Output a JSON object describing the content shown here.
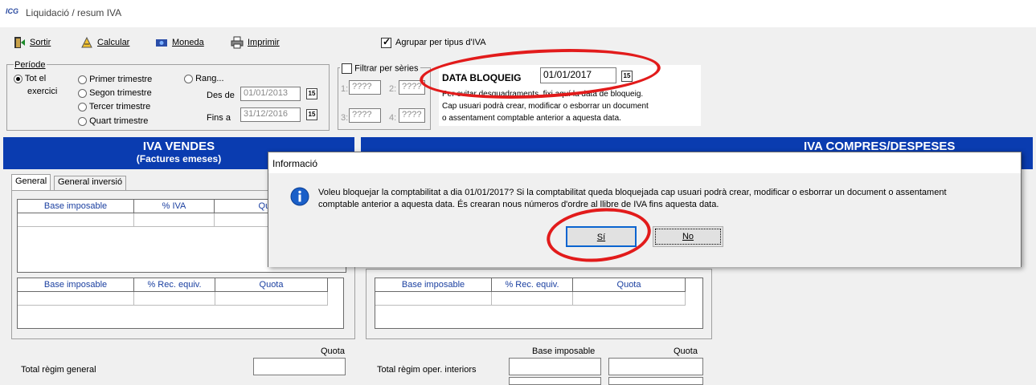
{
  "window": {
    "logo": "ICG",
    "title": "Liquidació / resum IVA"
  },
  "toolbar": {
    "sortir": "Sortir",
    "calcular": "Calcular",
    "moneda": "Moneda",
    "imprimir": "Imprimir",
    "agrupar": "Agrupar per tipus d'IVA",
    "agrupar_checked": true
  },
  "periode": {
    "label": "Període",
    "tot_el": "Tot el",
    "exercici": "exercici",
    "primer": "Primer trimestre",
    "segon": "Segon trimestre",
    "tercer": "Tercer trimestre",
    "quart": "Quart trimestre",
    "rang": "Rang...",
    "des_de": "Des de",
    "des_de_value": "01/01/2013",
    "fins_a": "Fins a",
    "fins_a_value": "31/12/2016",
    "selected": "tot_el"
  },
  "series": {
    "label": "Filtrar per sèries",
    "s1": "1:",
    "s2": "2:",
    "s3": "3:",
    "s4": "4:",
    "placeholder": "????"
  },
  "bloqueig": {
    "label": "DATA BLOQUEIG",
    "value": "01/01/2017",
    "desc1": "Per evitar desquadraments, fixi aquí la data de bloqueig.",
    "desc2": "Cap usuari podrà crear, modificar o esborrar un document",
    "desc3": "o assentament comptable anterior a aquesta data."
  },
  "vendes": {
    "title": "IVA VENDES",
    "subtitle": "(Factures emeses)",
    "tab_general": "General",
    "tab_inversio": "General inversió",
    "cols1": [
      "Base imposable",
      "% IVA",
      "Quota"
    ],
    "cols2": [
      "Base imposable",
      "% Rec. equiv.",
      "Quota"
    ],
    "quota_label": "Quota",
    "total_label": "Total règim general"
  },
  "compres": {
    "title": "IVA COMPRES/DESPESES",
    "cols2": [
      "Base imposable",
      "% Rec. equiv.",
      "Quota"
    ],
    "base_label": "Base imposable",
    "quota_label": "Quota",
    "total_label": "Total règim oper. interiors"
  },
  "dialog": {
    "title": "Informació",
    "message1": "Voleu bloquejar la comptabilitat a dia 01/01/2017? Si la comptabilitat queda bloquejada cap usuari podrà crear, modificar o esborrar un document o assentament",
    "message2": "comptable anterior a aquesta data. És crearan nous números d'ordre al llibre de IVA fins aquesta data.",
    "yes": "Sí",
    "no": "No"
  },
  "colors": {
    "header_blue": "#0a3cb0",
    "annotation_red": "#e21b1b",
    "info_blue": "#1a5fc8"
  }
}
